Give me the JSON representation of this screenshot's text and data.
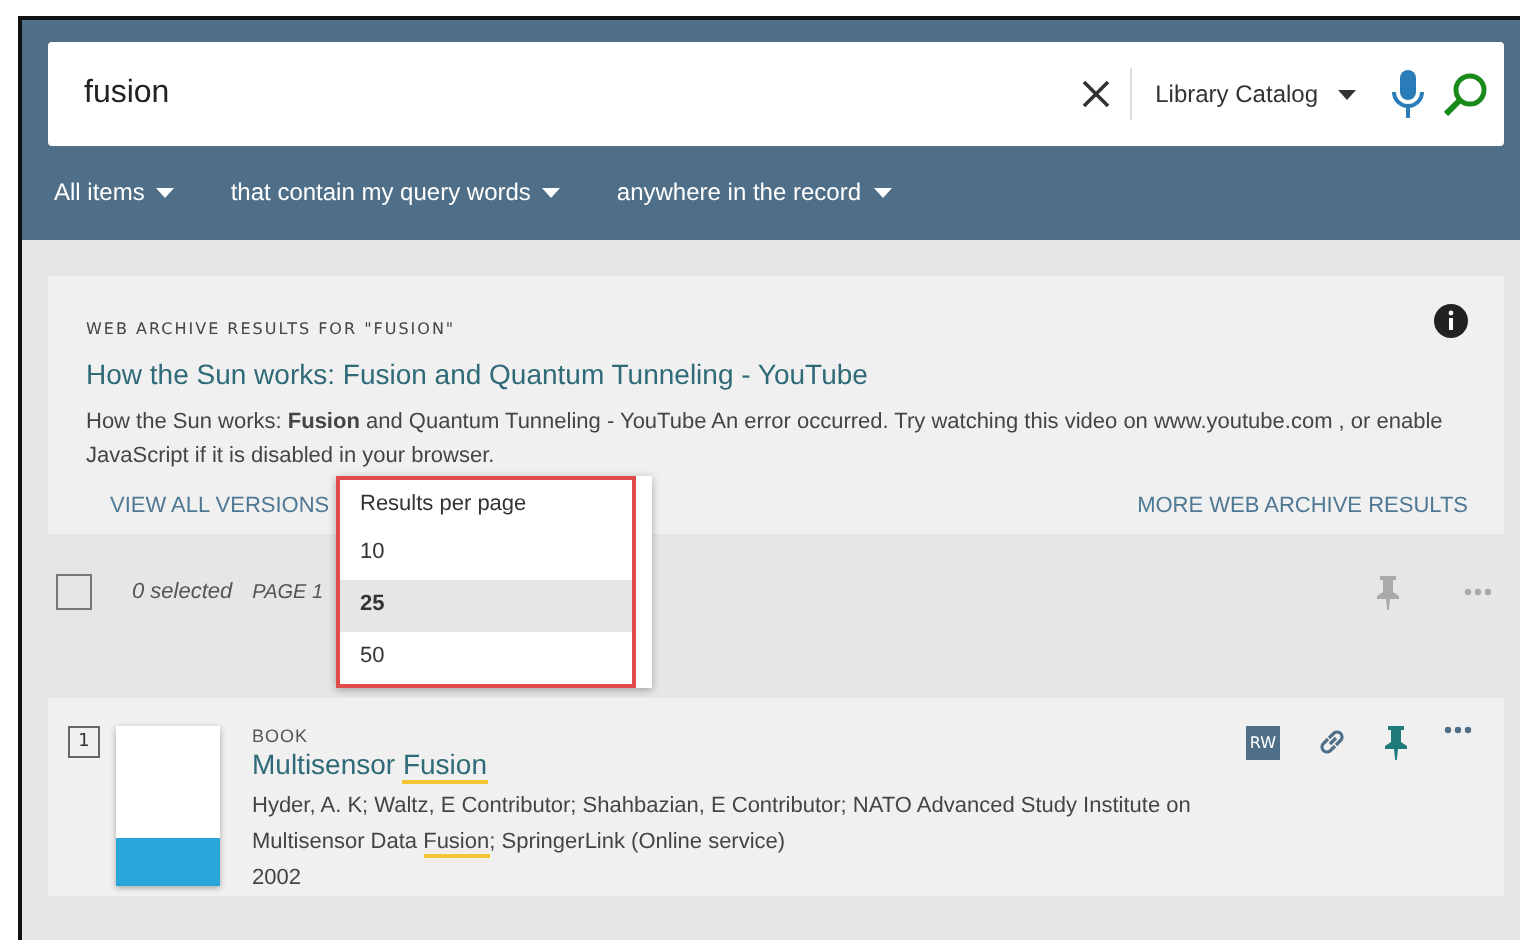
{
  "search": {
    "value": "fusion",
    "scope": "Library Catalog"
  },
  "filters": [
    {
      "label": "All items"
    },
    {
      "label": "that contain my query words"
    },
    {
      "label": "anywhere in the record"
    }
  ],
  "web_archive": {
    "heading": "WEB ARCHIVE RESULTS FOR \"FUSION\"",
    "title": "How the Sun works: Fusion and Quantum Tunneling - YouTube",
    "snippet": "How the Sun works: **Fusion** and Quantum Tunneling - YouTube An error occurred. Try watching this video on www.youtube.com , or enable JavaScript if it is disabled in your browser.",
    "view_all": "VIEW ALL VERSIONS",
    "more": "MORE WEB ARCHIVE RESULTS"
  },
  "toolbar": {
    "selected_count": "0 selected",
    "page": "PAGE 1",
    "select_all_checked": false
  },
  "results_per_page": {
    "title": "Results per page",
    "options": [
      {
        "label": "10",
        "selected": false
      },
      {
        "label": "25",
        "selected": true
      },
      {
        "label": "50",
        "selected": false
      }
    ]
  },
  "results": [
    {
      "number": "1",
      "type": "BOOK",
      "title": [
        {
          "text": "Multisensor ",
          "highlight": false
        },
        {
          "text": "Fusion",
          "highlight": true
        }
      ],
      "authors": [
        {
          "text": "Hyder, A. K; Waltz, E Contributor; Shahbazian, E Contributor; NATO Advanced Study Institute on Multisensor Data ",
          "highlight": false
        },
        {
          "text": "Fusion",
          "highlight": true
        },
        {
          "text": "; SpringerLink (Online service)",
          "highlight": false
        }
      ],
      "year": "2002",
      "badge": "RW",
      "pinned": true
    }
  ]
}
